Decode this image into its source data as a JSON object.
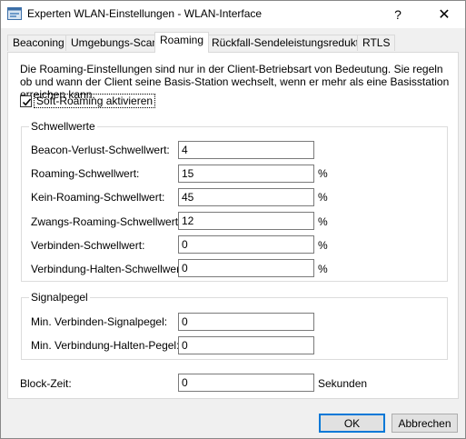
{
  "window": {
    "title": "Experten WLAN-Einstellungen - WLAN-Interface",
    "help_glyph": "?",
    "close_glyph": "✕"
  },
  "tabs": [
    {
      "label": "Beaconing",
      "active": false
    },
    {
      "label": "Umgebungs-Scan",
      "active": false
    },
    {
      "label": "Roaming",
      "active": true
    },
    {
      "label": "Rückfall-Sendeleistungsreduktion",
      "active": false
    },
    {
      "label": "RTLS",
      "active": false
    }
  ],
  "roaming": {
    "description": "Die Roaming-Einstellungen sind nur in der Client-Betriebsart von Bedeutung. Sie regeln ob und wann der Client seine Basis-Station wechselt, wenn er mehr als eine Basisstation erreichen kann.",
    "soft_roaming": {
      "label": "Soft-Roaming aktivieren",
      "checked": true
    }
  },
  "schwellwerte": {
    "title": "Schwellwerte",
    "fields": [
      {
        "label": "Beacon-Verlust-Schwellwert:",
        "value": "4",
        "unit": ""
      },
      {
        "label": "Roaming-Schwellwert:",
        "value": "15",
        "unit": "%"
      },
      {
        "label": "Kein-Roaming-Schwellwert:",
        "value": "45",
        "unit": "%"
      },
      {
        "label": "Zwangs-Roaming-Schwellwert:",
        "value": "12",
        "unit": "%"
      },
      {
        "label": "Verbinden-Schwellwert:",
        "value": "0",
        "unit": "%"
      },
      {
        "label": "Verbindung-Halten-Schwellwert:",
        "value": "0",
        "unit": "%"
      }
    ]
  },
  "signalpegel": {
    "title": "Signalpegel",
    "fields": [
      {
        "label": "Min. Verbinden-Signalpegel:",
        "value": "0"
      },
      {
        "label": "Min. Verbindung-Halten-Pegel:",
        "value": "0"
      }
    ]
  },
  "block_zeit": {
    "label": "Block-Zeit:",
    "value": "0",
    "unit": "Sekunden"
  },
  "buttons": {
    "ok": "OK",
    "cancel": "Abbrechen"
  }
}
